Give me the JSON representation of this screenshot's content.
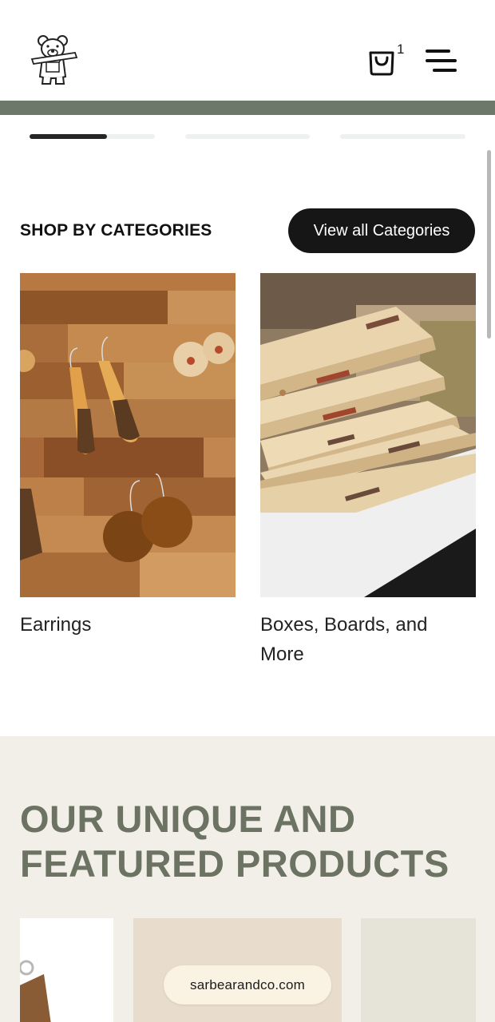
{
  "header": {
    "cart_count": "1"
  },
  "categories": {
    "title": "SHOP BY CATEGORIES",
    "view_all_label": "View all Categories",
    "items": [
      {
        "label": "Earrings"
      },
      {
        "label": "Boxes, Boards, and More"
      }
    ]
  },
  "slider": {
    "active_index": 0,
    "progress": 0.62
  },
  "featured": {
    "title": "OUR UNIQUE AND FEATURED PRODUCTS"
  },
  "url_pill": {
    "text": "sarbearandco.com"
  },
  "colors": {
    "accent_green": "#6e786a",
    "featured_bg": "#f2efe9",
    "button_dark": "#161616"
  },
  "icons": [
    "bear-logo-icon",
    "shopping-bag-icon",
    "hamburger-menu-icon"
  ]
}
